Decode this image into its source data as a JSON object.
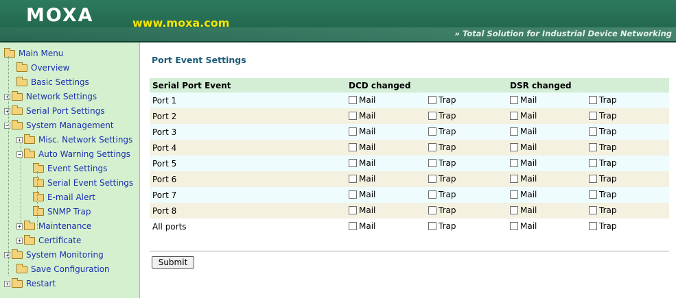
{
  "header": {
    "logo": "MOXA",
    "url": "www.moxa.com",
    "tagline": "» Total Solution for Industrial Device Networking"
  },
  "sidebar": {
    "items": [
      {
        "label": "Main Menu",
        "expander": "",
        "icon": "folder-open-icon"
      },
      {
        "label": "Overview",
        "expander": "",
        "icon": "folder-icon"
      },
      {
        "label": "Basic Settings",
        "expander": "",
        "icon": "folder-icon"
      },
      {
        "label": "Network Settings",
        "expander": "+",
        "icon": "folder-icon"
      },
      {
        "label": "Serial Port Settings",
        "expander": "+",
        "icon": "folder-icon"
      },
      {
        "label": "System Management",
        "expander": "−",
        "icon": "folder-open-icon"
      },
      {
        "label": "Misc. Network Settings",
        "expander": "+",
        "icon": "folder-icon"
      },
      {
        "label": "Auto Warning Settings",
        "expander": "−",
        "icon": "folder-open-icon"
      },
      {
        "label": "Event Settings",
        "expander": "",
        "icon": "folder-icon"
      },
      {
        "label": "Serial Event Settings",
        "expander": "",
        "icon": "folder-icon"
      },
      {
        "label": "E-mail Alert",
        "expander": "",
        "icon": "folder-icon"
      },
      {
        "label": "SNMP Trap",
        "expander": "",
        "icon": "folder-icon"
      },
      {
        "label": "Maintenance",
        "expander": "+",
        "icon": "folder-icon"
      },
      {
        "label": "Certificate",
        "expander": "+",
        "icon": "folder-icon"
      },
      {
        "label": "System Monitoring",
        "expander": "+",
        "icon": "folder-icon"
      },
      {
        "label": "Save Configuration",
        "expander": "",
        "icon": "folder-icon"
      },
      {
        "label": "Restart",
        "expander": "+",
        "icon": "folder-icon"
      }
    ]
  },
  "main": {
    "title": "Port Event Settings",
    "table": {
      "headers": [
        "Serial Port Event",
        "DCD changed",
        "",
        "DSR changed",
        ""
      ],
      "mail_label": "Mail",
      "trap_label": "Trap",
      "rows": [
        {
          "port": "Port 1",
          "dcd_mail": false,
          "dcd_trap": false,
          "dsr_mail": false,
          "dsr_trap": false
        },
        {
          "port": "Port 2",
          "dcd_mail": false,
          "dcd_trap": false,
          "dsr_mail": false,
          "dsr_trap": false
        },
        {
          "port": "Port 3",
          "dcd_mail": false,
          "dcd_trap": false,
          "dsr_mail": false,
          "dsr_trap": false
        },
        {
          "port": "Port 4",
          "dcd_mail": false,
          "dcd_trap": false,
          "dsr_mail": false,
          "dsr_trap": false
        },
        {
          "port": "Port 5",
          "dcd_mail": false,
          "dcd_trap": false,
          "dsr_mail": false,
          "dsr_trap": false
        },
        {
          "port": "Port 6",
          "dcd_mail": false,
          "dcd_trap": false,
          "dsr_mail": false,
          "dsr_trap": false
        },
        {
          "port": "Port 7",
          "dcd_mail": false,
          "dcd_trap": false,
          "dsr_mail": false,
          "dsr_trap": false
        },
        {
          "port": "Port 8",
          "dcd_mail": false,
          "dcd_trap": false,
          "dsr_mail": false,
          "dsr_trap": false
        },
        {
          "port": "All ports",
          "dcd_mail": false,
          "dcd_trap": false,
          "dsr_mail": false,
          "dsr_trap": false
        }
      ]
    },
    "submit_label": "Submit"
  }
}
